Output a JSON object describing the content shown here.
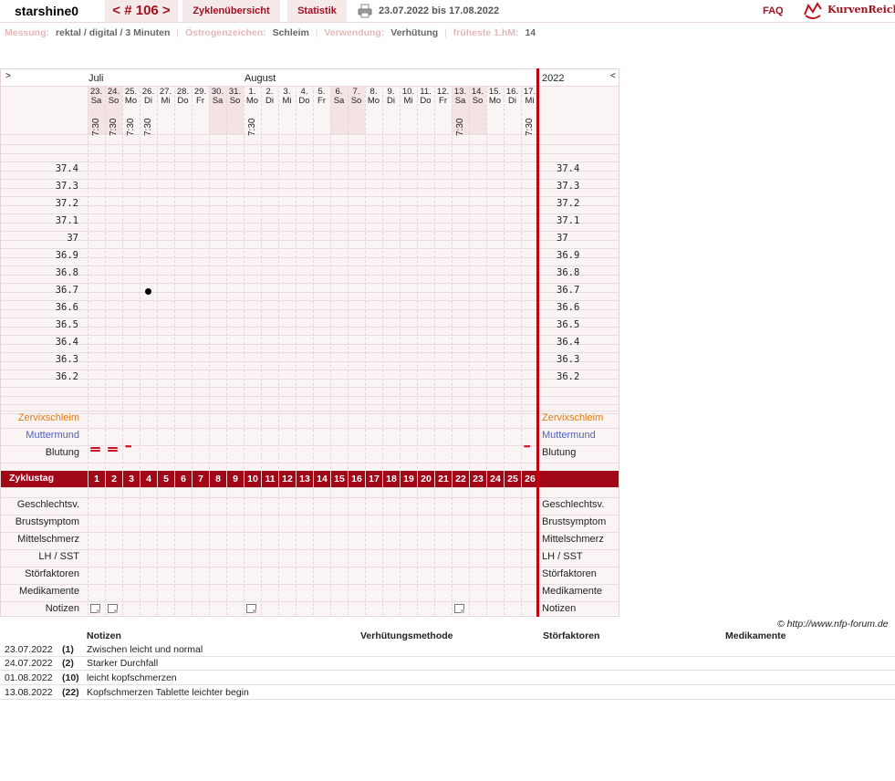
{
  "header": {
    "username": "starshine0",
    "cycle": "< # 106 >",
    "overview": "Zyklenübersicht",
    "stats": "Statistik",
    "daterange": "23.07.2022 bis 17.08.2022",
    "faq": "FAQ",
    "logo": "KurvenReich"
  },
  "info": {
    "measure_label": "Messung:",
    "measure_value": "rektal / digital / 3 Minuten",
    "estrogen_label": "Östrogenzeichen:",
    "estrogen_value": "Schleim",
    "usage_label": "Verwendung:",
    "usage_value": "Verhütung",
    "hm_label": "früheste 1.hM:",
    "hm_value": "14"
  },
  "chart": {
    "prev_arrow": ">",
    "next_arrow": "<",
    "month1": "Juli",
    "month2": "August",
    "year": "2022",
    "days": [
      {
        "d": "23.",
        "w": "Sa",
        "t": "7:30",
        "we": true
      },
      {
        "d": "24.",
        "w": "So",
        "t": "7:30",
        "we": true
      },
      {
        "d": "25.",
        "w": "Mo",
        "t": "7:30",
        "we": false
      },
      {
        "d": "26.",
        "w": "Di",
        "t": "7:30",
        "we": false
      },
      {
        "d": "27.",
        "w": "Mi",
        "t": "",
        "we": false
      },
      {
        "d": "28.",
        "w": "Do",
        "t": "",
        "we": false
      },
      {
        "d": "29.",
        "w": "Fr",
        "t": "",
        "we": false
      },
      {
        "d": "30.",
        "w": "Sa",
        "t": "",
        "we": true
      },
      {
        "d": "31.",
        "w": "So",
        "t": "",
        "we": true
      },
      {
        "d": "1.",
        "w": "Mo",
        "t": "7:30",
        "we": false
      },
      {
        "d": "2.",
        "w": "Di",
        "t": "",
        "we": false
      },
      {
        "d": "3.",
        "w": "Mi",
        "t": "",
        "we": false
      },
      {
        "d": "4.",
        "w": "Do",
        "t": "",
        "we": false
      },
      {
        "d": "5.",
        "w": "Fr",
        "t": "",
        "we": false
      },
      {
        "d": "6.",
        "w": "Sa",
        "t": "",
        "we": true
      },
      {
        "d": "7.",
        "w": "So",
        "t": "",
        "we": true
      },
      {
        "d": "8.",
        "w": "Mo",
        "t": "",
        "we": false
      },
      {
        "d": "9.",
        "w": "Di",
        "t": "",
        "we": false
      },
      {
        "d": "10.",
        "w": "Mi",
        "t": "",
        "we": false
      },
      {
        "d": "11.",
        "w": "Do",
        "t": "",
        "we": false
      },
      {
        "d": "12.",
        "w": "Fr",
        "t": "",
        "we": false
      },
      {
        "d": "13.",
        "w": "Sa",
        "t": "7:30",
        "we": true
      },
      {
        "d": "14.",
        "w": "So",
        "t": "",
        "we": true
      },
      {
        "d": "15.",
        "w": "Mo",
        "t": "",
        "we": false
      },
      {
        "d": "16.",
        "w": "Di",
        "t": "",
        "we": false
      },
      {
        "d": "17.",
        "w": "Mi",
        "t": "7:30",
        "we": false
      }
    ],
    "temp_labels": [
      "37.4",
      "37.3",
      "37.2",
      "37.1",
      "37",
      "36.9",
      "36.8",
      "36.7",
      "36.6",
      "36.5",
      "36.4",
      "36.3",
      "36.2"
    ],
    "temperatures": [
      {
        "day_index": 3,
        "value": 36.7
      }
    ],
    "rows": {
      "zervix": "Zervixschleim",
      "muttermund": "Muttermund",
      "blutung": "Blutung",
      "zyklustag": "Zyklustag",
      "geschlechtsv": "Geschlechtsv.",
      "brust": "Brustsymptom",
      "mittel": "Mittelschmerz",
      "lh": "LH / SST",
      "stoer": "Störfaktoren",
      "medi": "Medikamente",
      "notizen": "Notizen"
    },
    "bleeding": [
      {
        "day_index": 0,
        "type": "heavy"
      },
      {
        "day_index": 1,
        "type": "heavy"
      },
      {
        "day_index": 2,
        "type": "light"
      },
      {
        "day_index": 25,
        "type": "light"
      }
    ],
    "note_days": [
      0,
      1,
      9,
      21
    ],
    "colors": {
      "accent": "#a00818",
      "redline": "#c00010",
      "zervix": "#e07a10",
      "muttermund": "#5060c0",
      "blood": "#d01020"
    }
  },
  "footer": {
    "copyright": "© http://www.nfp-forum.de",
    "col_notes": "Notizen",
    "col_method": "Verhütungsmethode",
    "col_stoer": "Störfaktoren",
    "col_medi": "Medikamente",
    "notes": [
      {
        "date": "23.07.2022",
        "day": "(1)",
        "text": "Zwischen leicht und normal"
      },
      {
        "date": "24.07.2022",
        "day": "(2)",
        "text": "Starker Durchfall"
      },
      {
        "date": "01.08.2022",
        "day": "(10)",
        "text": "leicht kopfschmerzen"
      },
      {
        "date": "13.08.2022",
        "day": "(22)",
        "text": "Kopfschmerzen Tablette leichter begin"
      }
    ]
  }
}
